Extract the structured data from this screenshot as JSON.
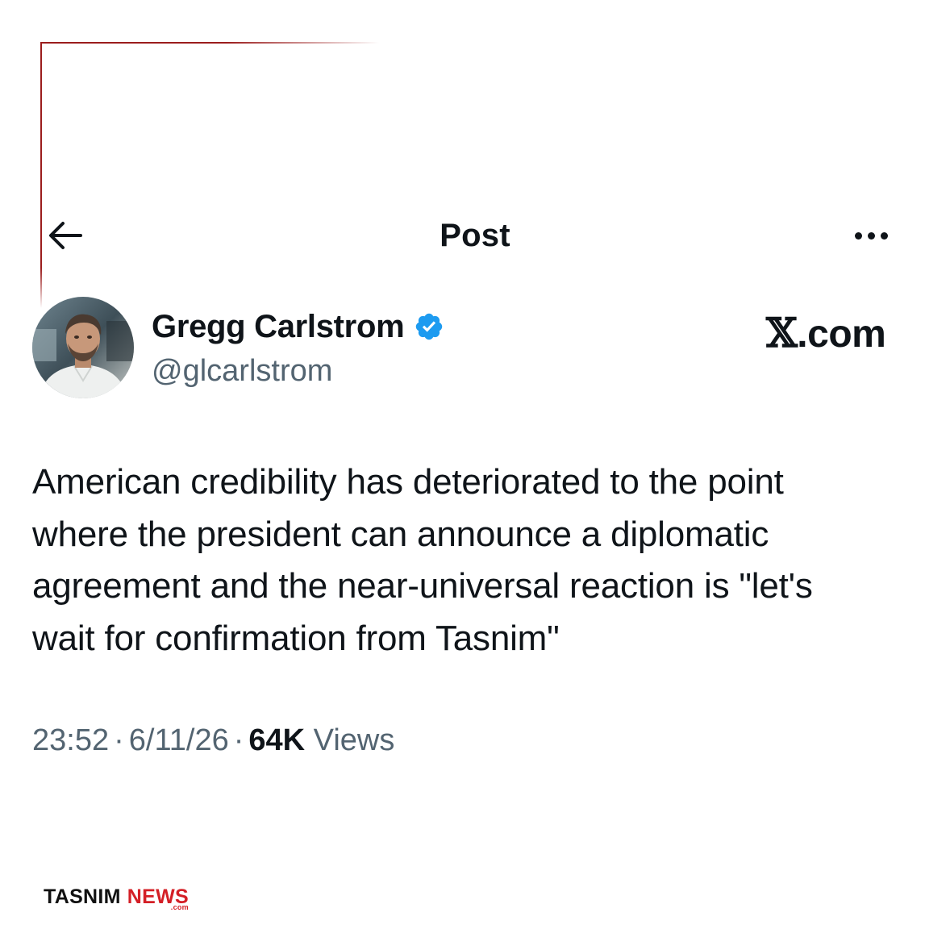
{
  "header": {
    "title": "Post",
    "back_icon": "arrow-left-icon",
    "more_icon": "more-horizontal-icon"
  },
  "author": {
    "name": "Gregg Carlstrom",
    "handle": "@glcarlstrom",
    "verified": true,
    "verified_color": "#1d9bf0"
  },
  "site_label": {
    "logo": "𝕏",
    "suffix": ".com"
  },
  "post": {
    "text": "American credibility has deteriorated to the point\nwhere the president can announce a diplomatic\nagreement and the near-universal reaction is \"let's\nwait for confirmation from Tasnim\""
  },
  "meta": {
    "time": "23:52",
    "separator": "·",
    "date": "6/11/26",
    "views_count": "64K",
    "views_label": "Views"
  },
  "brand": {
    "word_1": "TASNIM",
    "word_2": "NEWS",
    "suffix": ".com",
    "accent_color": "#d41f26"
  },
  "colors": {
    "text_primary": "#0f1419",
    "text_secondary": "#536471",
    "frame_accent": "#9b1d1d"
  }
}
